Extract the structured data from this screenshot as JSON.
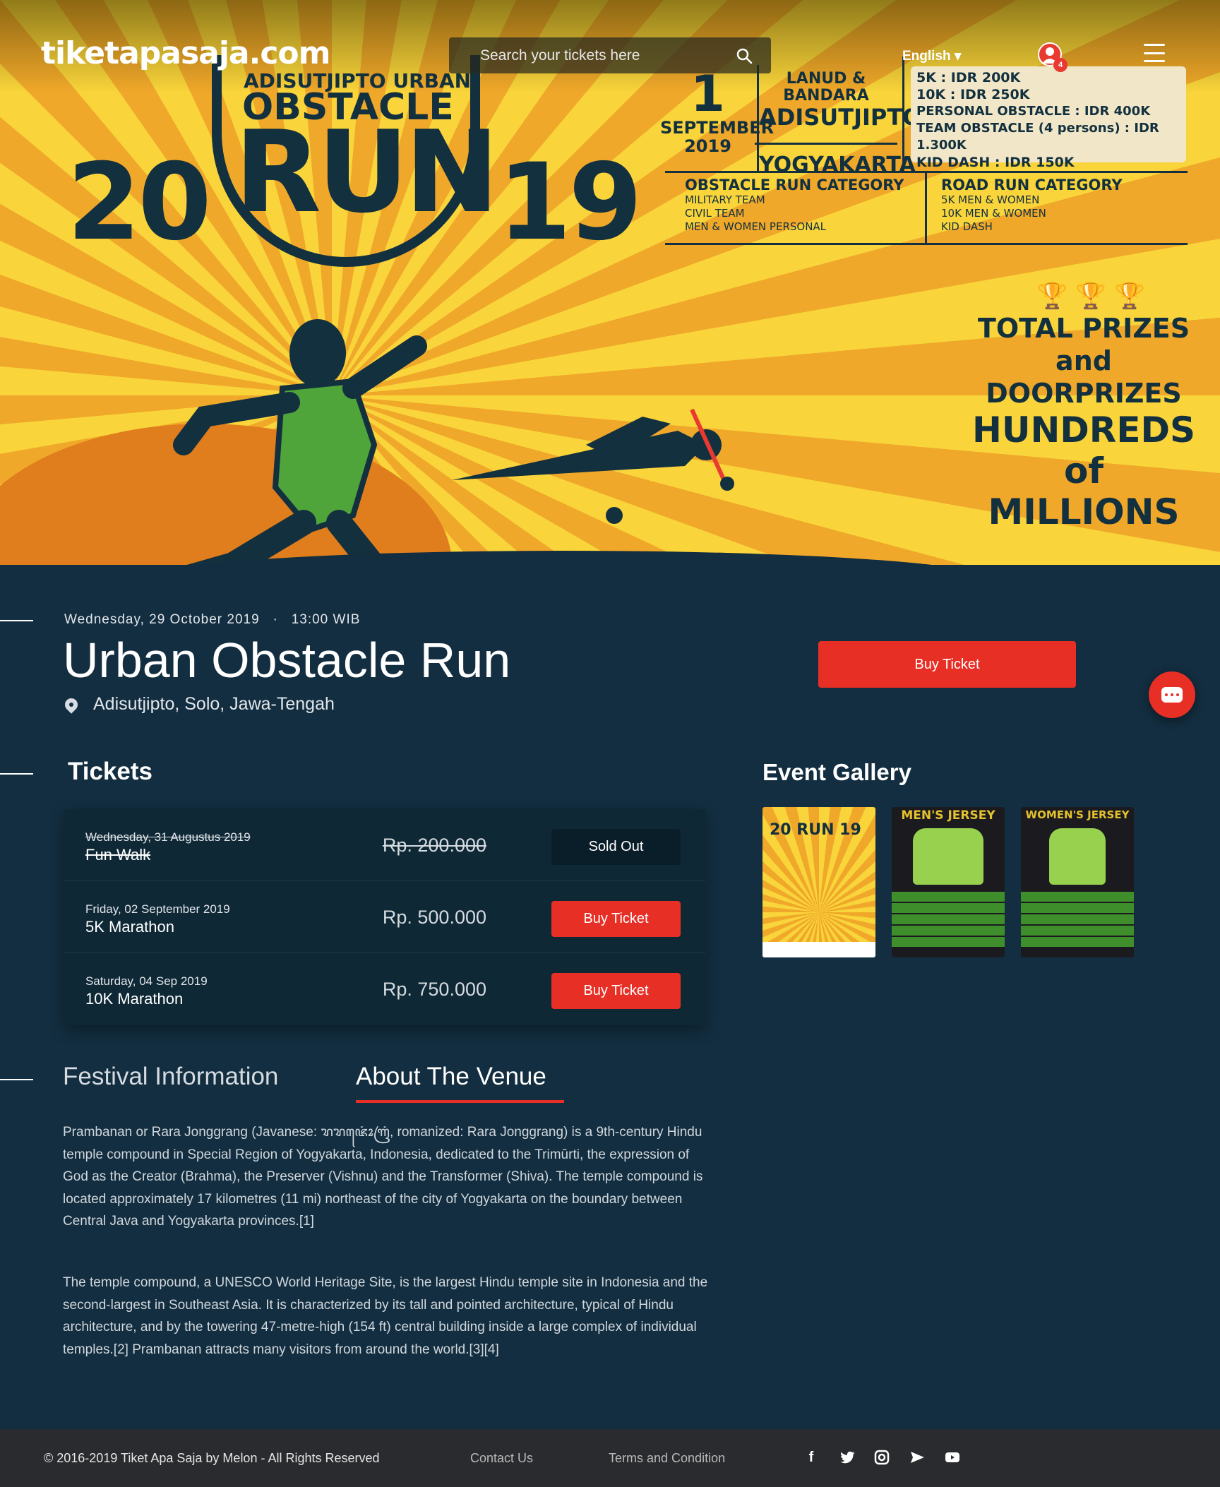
{
  "header": {
    "logo": "tiketapasaja.com",
    "search_placeholder": "Search your tickets here",
    "language": "English ▾",
    "notification_count": "4"
  },
  "poster": {
    "year_left": "20",
    "year_right": "19",
    "title_line1": "ADISUTJIPTO URBAN",
    "title_line2": "OBSTACLE",
    "title_line3": "RUN",
    "date_day": "1",
    "date_month": "SEPTEMBER",
    "date_year": "2019",
    "venue_line1": "LANUD & BANDARA",
    "venue_line2": "ADISUTJIPTO",
    "venue_city": "YOGYAKARTA",
    "prices": [
      "5K    : IDR 200K",
      "10K  : IDR 250K",
      "PERSONAL OBSTACLE   : IDR 400K",
      "TEAM OBSTACLE (4 persons) : IDR 1.300K",
      "KID DASH : IDR 150K"
    ],
    "obstacle_category": {
      "title": "OBSTACLE RUN CATEGORY",
      "items": [
        "MILITARY TEAM",
        "CIVIL TEAM",
        "MEN & WOMEN PERSONAL"
      ]
    },
    "road_category": {
      "title": "ROAD RUN CATEGORY",
      "items": [
        "5K MEN & WOMEN",
        "10K MEN & WOMEN",
        "KID DASH"
      ]
    },
    "prizes": [
      "TOTAL PRIZES",
      "and",
      "DOORPRIZES",
      "HUNDREDS",
      "of",
      "MILLIONS"
    ]
  },
  "event": {
    "date": "Wednesday, 29 October 2019",
    "separator": "·",
    "time": "13:00 WIB",
    "title": "Urban Obstacle Run",
    "location": "Adisutjipto, Solo, Jawa-Tengah",
    "buy_label": "Buy Ticket"
  },
  "tickets": {
    "heading": "Tickets",
    "rows": [
      {
        "date": "Wednesday, 31 Augustus 2019",
        "name": "Fun Walk",
        "price": "Rp. 200.000",
        "button": "Sold Out",
        "status": "sold-out"
      },
      {
        "date": "Friday, 02 September 2019",
        "name": "5K Marathon",
        "price": "Rp. 500.000",
        "button": "Buy Ticket",
        "status": "available"
      },
      {
        "date": "Saturday, 04 Sep 2019",
        "name": "10K Marathon",
        "price": "Rp. 750.000",
        "button": "Buy Ticket",
        "status": "available"
      }
    ]
  },
  "gallery": {
    "heading": "Event Gallery",
    "items": [
      {
        "label": "20 RUN 19"
      },
      {
        "label": "MEN'S JERSEY"
      },
      {
        "label": "WOMEN'S JERSEY"
      }
    ]
  },
  "tabs": {
    "festival": "Festival Information",
    "venue": "About The Venue"
  },
  "about": {
    "p1": "Prambanan or Rara Jonggrang (Javanese: ꦫꦫꦗꦺꦴꦁꦒꦿꦁ, romanized: Rara Jonggrang) is a 9th-century Hindu temple compound in Special Region of Yogyakarta, Indonesia, dedicated to the Trimūrti, the expression of God as the Creator (Brahma), the Preserver (Vishnu) and the Transformer (Shiva). The temple compound is located approximately 17 kilometres (11 mi) northeast of the city of Yogyakarta on the boundary between Central Java and Yogyakarta provinces.[1]",
    "p2": "The temple compound, a UNESCO World Heritage Site, is the largest Hindu temple site in Indonesia and the second-largest in Southeast Asia. It is characterized by its tall and pointed architecture, typical of Hindu architecture, and by the towering 47-metre-high (154 ft) central building inside a large complex of individual temples.[2] Prambanan attracts many visitors from around the world.[3][4]"
  },
  "footer": {
    "copyright": "© 2016-2019 Tiket Apa Saja by Melon - All Rights Reserved",
    "contact": "Contact Us",
    "terms": "Terms and Condition",
    "social_icons": [
      "facebook-icon",
      "twitter-icon",
      "instagram-icon",
      "telegram-icon",
      "youtube-icon"
    ]
  },
  "colors": {
    "background": "#132e40",
    "accent": "#e82f25",
    "poster_yellow": "#f9d43a",
    "poster_orange": "#f0a82a",
    "footer": "#2a2b2e"
  }
}
